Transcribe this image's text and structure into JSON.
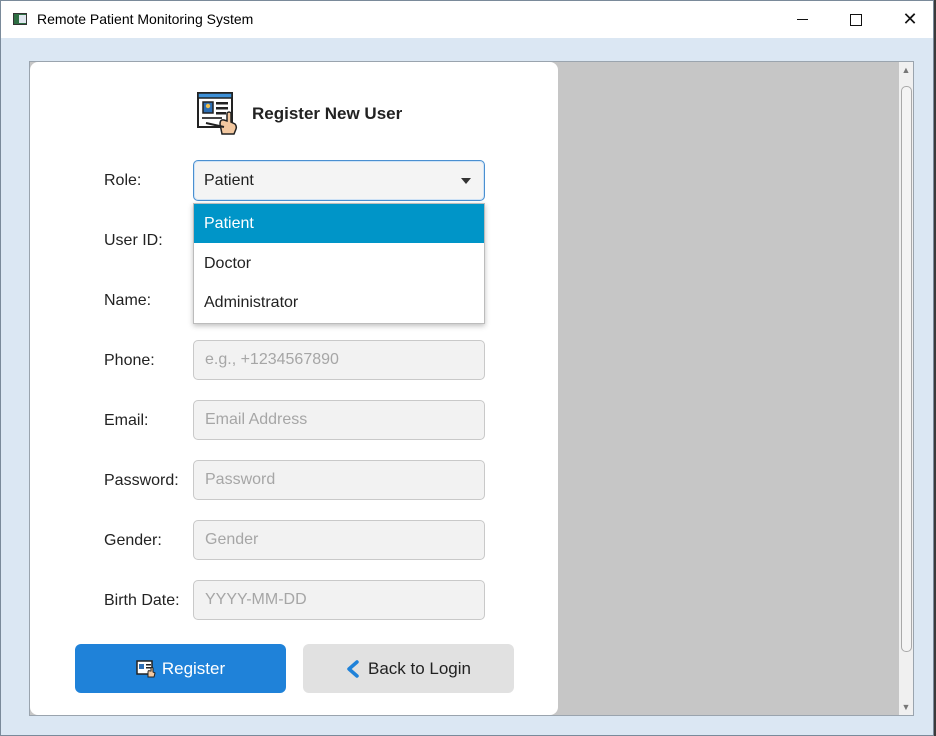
{
  "window": {
    "title": "Remote Patient Monitoring System",
    "controls": {
      "minimize": "minimize",
      "maximize": "maximize",
      "close": "close"
    }
  },
  "form": {
    "title": "Register New User",
    "role": {
      "label": "Role:",
      "value": "Patient",
      "options": [
        "Patient",
        "Doctor",
        "Administrator"
      ],
      "selected_index": 0
    },
    "user_id": {
      "label": "User ID:",
      "value": ""
    },
    "name": {
      "label": "Name:",
      "value": ""
    },
    "phone": {
      "label": "Phone:",
      "placeholder": "e.g., +1234567890",
      "value": ""
    },
    "email": {
      "label": "Email:",
      "placeholder": "Email Address",
      "value": ""
    },
    "password": {
      "label": "Password:",
      "placeholder": "Password",
      "value": ""
    },
    "gender": {
      "label": "Gender:",
      "placeholder": "Gender",
      "value": ""
    },
    "birth_date": {
      "label": "Birth Date:",
      "placeholder": "YYYY-MM-DD",
      "value": ""
    },
    "buttons": {
      "register": "Register",
      "back": "Back to Login"
    }
  },
  "colors": {
    "primary": "#1f82d9",
    "selection": "#0095c8",
    "secondary_button": "#e1e1e1",
    "right_pane": "#c6c6c6"
  }
}
